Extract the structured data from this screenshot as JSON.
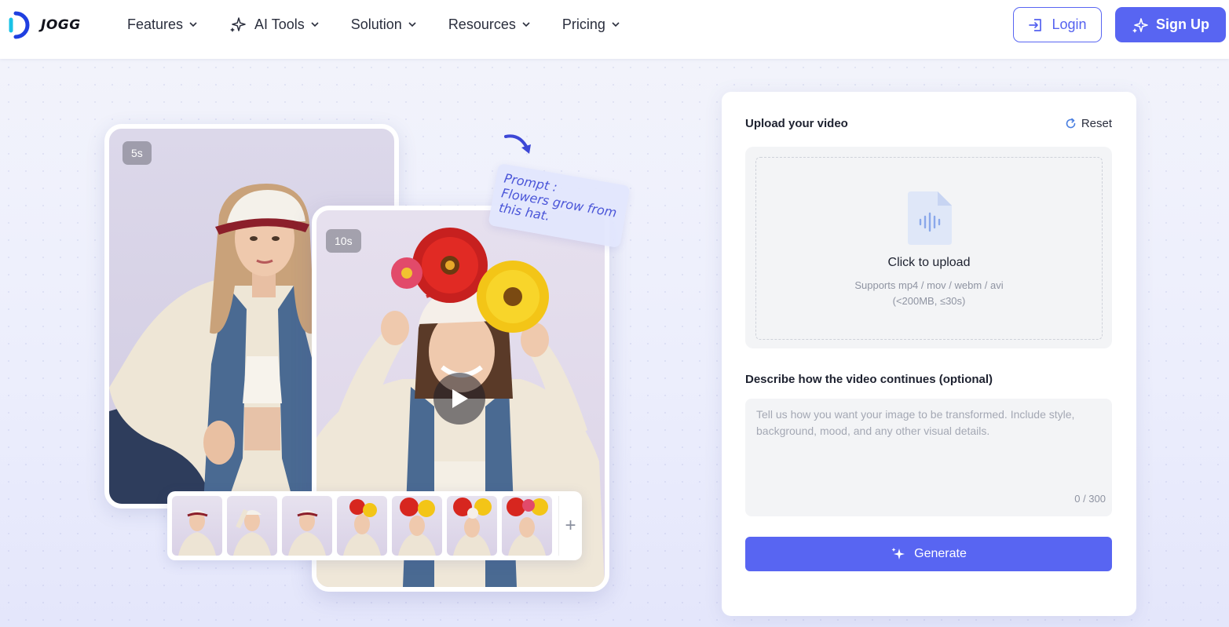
{
  "header": {
    "logo_text": "JOGG",
    "nav": [
      {
        "label": "Features"
      },
      {
        "label": "AI Tools"
      },
      {
        "label": "Solution"
      },
      {
        "label": "Resources"
      },
      {
        "label": "Pricing"
      }
    ],
    "login_label": "Login",
    "signup_label": "Sign Up"
  },
  "showcase": {
    "badge_original": "5s",
    "badge_extended": "10s",
    "prompt_note": "Prompt :\nFlowers grow from this hat.",
    "thumb_add": "+"
  },
  "panel": {
    "title": "Upload your video",
    "reset_label": "Reset",
    "upload_title": "Click to upload",
    "upload_hint_line1": "Supports mp4 / mov / webm / avi",
    "upload_hint_line2": "(<200MB, ≤30s)",
    "describe_label": "Describe how the video continues (optional)",
    "describe_placeholder": "Tell us how you want your image to be transformed. Include style, background, mood, and any other visual details.",
    "describe_value": "",
    "counter": "0 / 300",
    "generate_label": "Generate"
  },
  "colors": {
    "accent": "#5865f2",
    "logo_blue": "#1f3fe0",
    "logo_cyan": "#19c2e6"
  }
}
